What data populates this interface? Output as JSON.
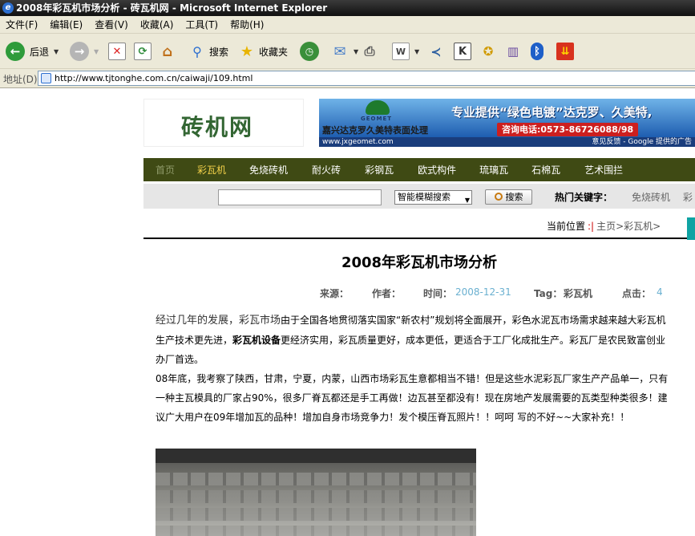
{
  "window": {
    "title": "2008年彩瓦机市场分析 - 砖瓦机网 - Microsoft Internet Explorer"
  },
  "menu": [
    "文件(F)",
    "编辑(E)",
    "查看(V)",
    "收藏(A)",
    "工具(T)",
    "帮助(H)"
  ],
  "toolbar": {
    "back": "后退",
    "search": "搜索",
    "favorites": "收藏夹"
  },
  "address": {
    "label": "地址(D)",
    "url": "http://www.tjtonghe.com.cn/caiwaji/109.html"
  },
  "site": {
    "logo": "砖机网"
  },
  "ad": {
    "brand": "GEOMET",
    "company": "嘉兴达克罗久美特表面处理",
    "slogan": "专业提供“绿色电镀”达克罗、久美特,",
    "phone": "咨询电话:0573-86726088/98",
    "url": "www.jxgeomet.com",
    "feedback": "意见反馈 - Google 提供的广告"
  },
  "nav": [
    "首页",
    "彩瓦机",
    "免烧砖机",
    "耐火砖",
    "彩钢瓦",
    "欧式构件",
    "琉璃瓦",
    "石棉瓦",
    "艺术围拦"
  ],
  "search": {
    "mode": "智能模糊搜索",
    "button": "搜索",
    "hot_label": "热门关键字：",
    "hot_1": "免烧砖机",
    "hot_2": "彩"
  },
  "breadcrumb": {
    "label": "当前位置",
    "separator": ":|",
    "path": "主页>彩瓦机>"
  },
  "article": {
    "title": "2008年彩瓦机市场分析",
    "source_label": "来源：",
    "author_label": "作者：",
    "time_label": "时间：",
    "time_value": "2008-12-31",
    "tag_label": "Tag：",
    "tag_value": "彩瓦机",
    "clicks_label": "点击：",
    "clicks_value": "4",
    "p1_lead": "经过几年的发展，彩瓦市场",
    "p1_a": "由于全国各地贯彻落实国家“新农村”规划将全面展开，彩色水泥瓦市场需求越来越大彩瓦机生产技术更先进，",
    "p1_bold": "彩瓦机设备",
    "p1_b": "更经济实用，彩瓦质量更好，成本更低，更适合于工厂化成批生产。彩瓦厂是农民致富创业办厂首选。",
    "p2": "08年底，我考察了陕西，甘肃，宁夏，内蒙，山西市场彩瓦生意都相当不错！但是这些水泥彩瓦厂家生产产品单一，只有一种主瓦模具的厂家占90%，很多厂脊瓦都还是手工再做！边瓦甚至都没有！现在房地产发展需要的瓦类型种类很多！建议广大用户在09年增加瓦的品种！增加自身市场竞争力！发个模压脊瓦照片！！呵呵  写的不好~~大家补充！！"
  },
  "colors": {
    "nav_bg": "#3f4a14",
    "nav_active": "#f5d24a",
    "date_color": "#6ab0d0",
    "logo_color": "#336633"
  }
}
